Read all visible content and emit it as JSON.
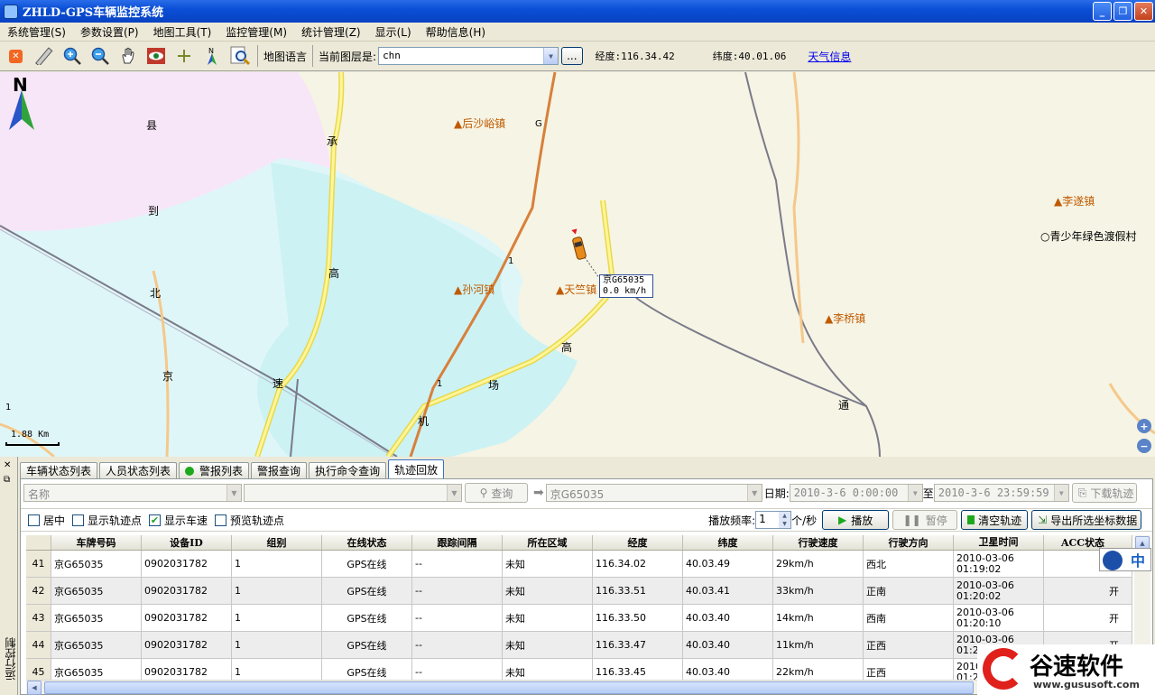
{
  "window": {
    "title": "ZHLD-GPS车辆监控系统"
  },
  "menu": [
    "系统管理(S)",
    "参数设置(P)",
    "地图工具(T)",
    "监控管理(M)",
    "统计管理(Z)",
    "显示(L)",
    "帮助信息(H)"
  ],
  "toolbar": {
    "map_language": "地图语言",
    "layer_label": "当前图层是:",
    "layer_value": "chn",
    "browse": "...",
    "lon_label": "经度:116.34.42",
    "lat_label": "纬度:40.01.06",
    "weather_link": "天气信息"
  },
  "map": {
    "north": "N",
    "road_chars": [
      "县",
      "承",
      "到",
      "高",
      "北",
      "京",
      "速",
      "1",
      "1",
      "高",
      "场",
      "机",
      "通",
      "G",
      "1"
    ],
    "towns": [
      "后沙峪镇",
      "孙河镇",
      "天竺镇",
      "李遂镇",
      "李桥镇"
    ],
    "village": "青少年绿色渡假村",
    "vehicle": {
      "plate": "京G65035",
      "speed": "0.0 km/h"
    },
    "scale": "1.88 Km"
  },
  "side_panel": {
    "label": "运行控制"
  },
  "tabs": [
    {
      "label": "车辆状态列表",
      "active": false
    },
    {
      "label": "人员状态列表",
      "active": false
    },
    {
      "label": "警报列表",
      "active": false
    },
    {
      "label": "警报查询",
      "active": false
    },
    {
      "label": "执行命令查询",
      "active": false
    },
    {
      "label": "轨迹回放",
      "active": true
    }
  ],
  "query": {
    "name_combo": "名称",
    "query_button": "查询",
    "plate_field": "京G65035",
    "date_label": "日期:",
    "start": "2010-3-6 0:00:00",
    "to_label": "至",
    "end": "2010-3-6 23:59:59",
    "download_button": "下载轨迹"
  },
  "controls": {
    "center": "居中",
    "show_points": "显示轨迹点",
    "show_speed": "显示车速",
    "preview_points": "预览轨迹点",
    "rate_label": "播放频率:",
    "rate_value": "1",
    "rate_unit": "个/秒",
    "play": "播放",
    "pause": "暂停",
    "clear": "清空轨迹",
    "export": "导出所选坐标数据"
  },
  "table": {
    "headers": [
      "车牌号码",
      "设备ID",
      "组别",
      "在线状态",
      "跟踪间隔",
      "所在区域",
      "经度",
      "纬度",
      "行驶速度",
      "行驶方向",
      "卫星时间",
      "ACC状态"
    ],
    "rows": [
      {
        "n": "41",
        "cells": [
          "京G65035",
          "0902031782",
          "1",
          "GPS在线",
          "--",
          "未知",
          "116.34.02",
          "40.03.49",
          "29km/h",
          "西北",
          "2010-03-06 01:19:02",
          "开"
        ]
      },
      {
        "n": "42",
        "cells": [
          "京G65035",
          "0902031782",
          "1",
          "GPS在线",
          "--",
          "未知",
          "116.33.51",
          "40.03.41",
          "33km/h",
          "正南",
          "2010-03-06 01:20:02",
          "开"
        ]
      },
      {
        "n": "43",
        "cells": [
          "京G65035",
          "0902031782",
          "1",
          "GPS在线",
          "--",
          "未知",
          "116.33.50",
          "40.03.40",
          "14km/h",
          "西南",
          "2010-03-06 01:20:10",
          "开"
        ]
      },
      {
        "n": "44",
        "cells": [
          "京G65035",
          "0902031782",
          "1",
          "GPS在线",
          "--",
          "未知",
          "116.33.47",
          "40.03.40",
          "11km/h",
          "正西",
          "2010-03-06 01:20:20",
          "开"
        ]
      },
      {
        "n": "45",
        "cells": [
          "京G65035",
          "0902031782",
          "1",
          "GPS在线",
          "--",
          "未知",
          "116.33.45",
          "40.03.40",
          "22km/h",
          "正西",
          "2010-03-06 01:20:30",
          "开"
        ]
      }
    ]
  },
  "ime": {
    "label": "中"
  },
  "watermark": {
    "text": "谷速软件",
    "url": "www.gususoft.com"
  }
}
